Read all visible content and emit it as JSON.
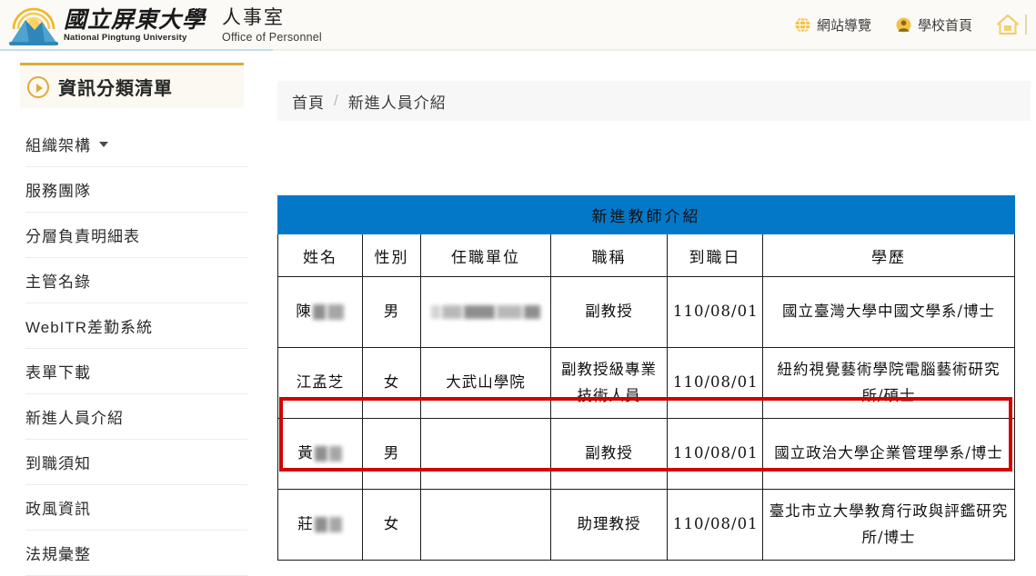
{
  "header": {
    "logo": {
      "icon": "sun-mountain-logo",
      "university_cn": "國立屏東大學",
      "university_en": "National Pingtung University"
    },
    "department_cn": "人事室",
    "department_en": "Office of Personnel",
    "topnav": [
      {
        "label": "網站導覽",
        "icon": "globe-icon"
      },
      {
        "label": "學校首頁",
        "icon": "person-icon"
      },
      {
        "label": "",
        "icon": "home-icon"
      }
    ]
  },
  "sidebar": {
    "panel_title": "資訊分類清單",
    "panel_icon": "circle-arrow-right-icon",
    "items": [
      {
        "label": "組織架構",
        "has_caret": true
      },
      {
        "label": "服務團隊",
        "has_caret": false
      },
      {
        "label": "分層負責明細表",
        "has_caret": false
      },
      {
        "label": "主管名錄",
        "has_caret": false
      },
      {
        "label": "WebITR差勤系統",
        "has_caret": false
      },
      {
        "label": "表單下載",
        "has_caret": false
      },
      {
        "label": "新進人員介紹",
        "has_caret": false
      },
      {
        "label": "到職須知",
        "has_caret": false
      },
      {
        "label": "政風資訊",
        "has_caret": false
      },
      {
        "label": "法規彙整",
        "has_caret": false
      }
    ]
  },
  "main": {
    "breadcrumb": {
      "home": "首頁",
      "separator": "/",
      "current": "新進人員介紹"
    },
    "table": {
      "title": "新進教師介紹",
      "title_bg": "#0478c8",
      "highlight_color": "#d30000",
      "columns": [
        "姓名",
        "性別",
        "任職單位",
        "職稱",
        "到職日",
        "學歷"
      ],
      "rows": [
        {
          "name": "陳",
          "name_redacted": true,
          "sex": "男",
          "unit": "",
          "unit_redacted": true,
          "job_title": "副教授",
          "start_date": "110/08/01",
          "education": "國立臺灣大學中國文學系/博士",
          "highlighted": false
        },
        {
          "name": "江孟芝",
          "name_redacted": false,
          "sex": "女",
          "unit": "大武山學院",
          "unit_redacted": false,
          "job_title": "副教授級專業技術人員",
          "start_date": "110/08/01",
          "education": "紐約視覺藝術學院電腦藝術研究所/碩士",
          "highlighted": true
        },
        {
          "name": "黃",
          "name_redacted": true,
          "sex": "男",
          "unit": "",
          "unit_redacted": true,
          "job_title": "副教授",
          "start_date": "110/08/01",
          "education": "國立政治大學企業管理學系/博士",
          "highlighted": false
        },
        {
          "name": "莊",
          "name_redacted": true,
          "sex": "女",
          "unit": "",
          "unit_redacted": true,
          "job_title": "助理教授",
          "start_date": "110/08/01",
          "education": "臺北市立大學教育行政與評鑑研究所/博士",
          "highlighted": false
        }
      ]
    }
  }
}
